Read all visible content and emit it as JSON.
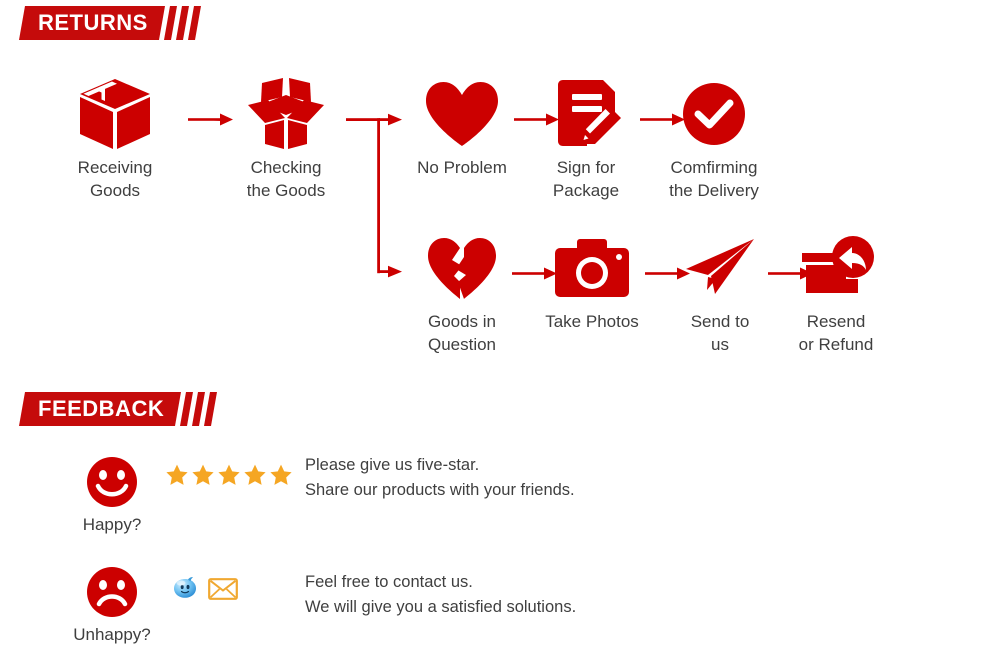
{
  "sections": {
    "returns": {
      "banner_title": "RETURNS"
    },
    "feedback": {
      "banner_title": "FEEDBACK"
    }
  },
  "returns_flow": {
    "main": [
      {
        "id": "receiving-goods",
        "icon": "closed-box-icon",
        "label": "Receiving\nGoods"
      },
      {
        "id": "checking-goods",
        "icon": "open-box-icon",
        "label": "Checking\nthe Goods"
      }
    ],
    "branch_ok": [
      {
        "id": "no-problem",
        "icon": "heart-icon",
        "label": "No Problem"
      },
      {
        "id": "sign-for-package",
        "icon": "document-pencil-icon",
        "label": "Sign for\nPackage"
      },
      {
        "id": "comfirming-delivery",
        "icon": "check-circle-icon",
        "label": "Comfirming\nthe Delivery"
      }
    ],
    "branch_issue": [
      {
        "id": "goods-in-question",
        "icon": "broken-heart-icon",
        "label": "Goods in\nQuestion"
      },
      {
        "id": "take-photos",
        "icon": "camera-icon",
        "label": "Take Photos"
      },
      {
        "id": "send-to-us",
        "icon": "paper-plane-icon",
        "label": "Send to\nus"
      },
      {
        "id": "resend-or-refund",
        "icon": "box-return-arrow-icon",
        "label": "Resend\nor Refund"
      }
    ]
  },
  "feedback": {
    "happy": {
      "face_icon": "smiley-face-icon",
      "face_label": "Happy?",
      "rating_icon": "star-icon",
      "rating_stars": 5,
      "message": "Please give us five-star.\nShare our products with your friends."
    },
    "unhappy": {
      "face_icon": "sad-face-icon",
      "face_label": "Unhappy?",
      "contact_icons": [
        "chat-bubble-icon",
        "envelope-icon"
      ],
      "message": "Feel free to contact us.\nWe will give you a satisfied solutions."
    }
  },
  "colors": {
    "brand_red": "#c50b0b",
    "icon_red": "#cc0000",
    "star_orange": "#f5a623",
    "text_gray": "#3f3f3f",
    "chat_blue": "#4aa3e8",
    "envelope_orange": "#f0a830"
  }
}
